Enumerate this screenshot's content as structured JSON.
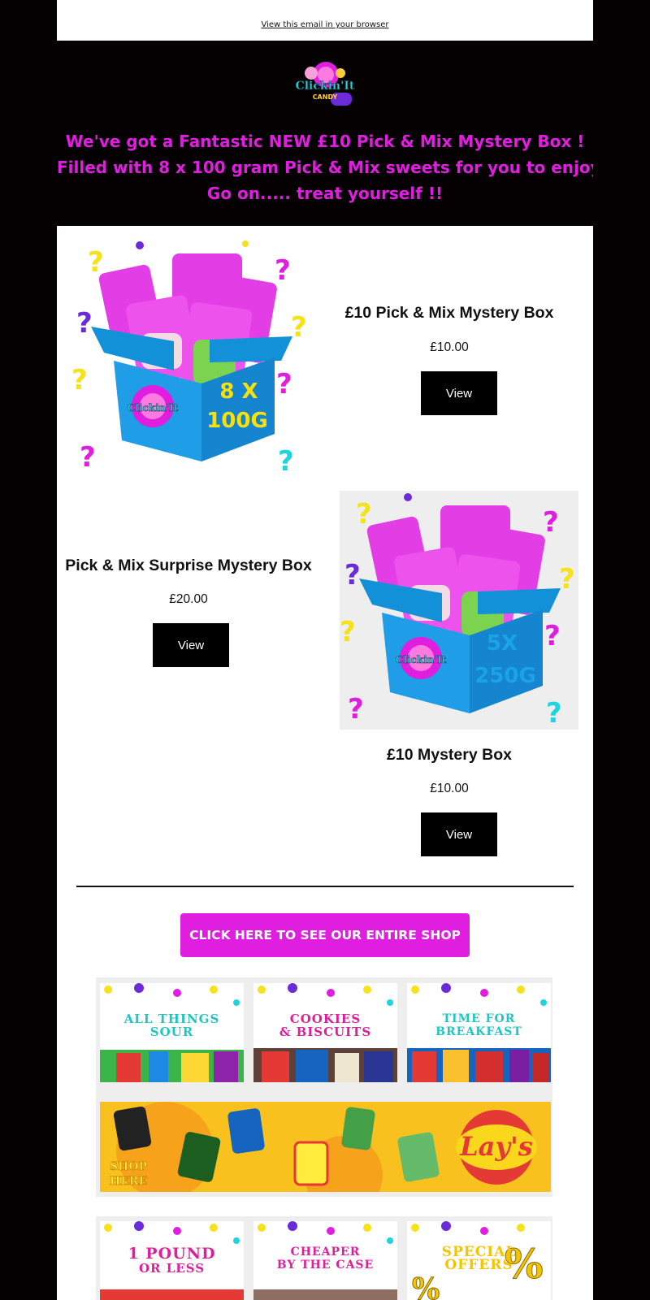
{
  "header": {
    "view_in_browser": "View this email in your browser"
  },
  "hero": {
    "logo_line1": "Clickin'It",
    "logo_line2": "CANDY",
    "line1": "We've got a Fantastic NEW £10 Pick & Mix Mystery Box !",
    "line2": "Filled with 8 x 100 gram Pick & Mix sweets for you to enjoy.",
    "line3": "Go on..... treat yourself !!",
    "accent_color": "#e01ee0"
  },
  "products": [
    {
      "title": "£10 Pick & Mix Mystery Box",
      "price": "£10.00",
      "button": "View",
      "box_label_1": "8 X",
      "box_label_2": "100G",
      "box_label_color": "#f6e10e"
    },
    {
      "title": "Pick & Mix Surprise Mystery Box",
      "price": "£20.00",
      "button": "View",
      "box_label_1": "5X",
      "box_label_2": "250G",
      "box_label_color": "#1aa3e6"
    },
    {
      "title": "£10 Mystery Box",
      "price": "£10.00",
      "button": "View"
    }
  ],
  "shop_button": "CLICK HERE TO SEE OUR ENTIRE SHOP",
  "categories": {
    "row1": [
      {
        "line1": "ALL THINGS",
        "line2": "SOUR",
        "color": "#1fc6c2"
      },
      {
        "line1": "COOKIES",
        "line2": "& BISCUITS",
        "color": "#e01e9c"
      },
      {
        "line1": "TIME FOR",
        "line2": "BREAKFAST",
        "color": "#1fc6c2"
      }
    ],
    "banner": {
      "shop_here": "SHOP HERE",
      "brand": "Lay's"
    },
    "row2": [
      {
        "line1": "1 POUND",
        "line2": "OR LESS",
        "color": "#e01e9c"
      },
      {
        "line1": "CHEAPER",
        "line2": "BY THE CASE",
        "color": "#e01e9c"
      },
      {
        "line1": "SPECIAL",
        "line2": "OFFERS",
        "color": "#f5c400"
      }
    ]
  }
}
